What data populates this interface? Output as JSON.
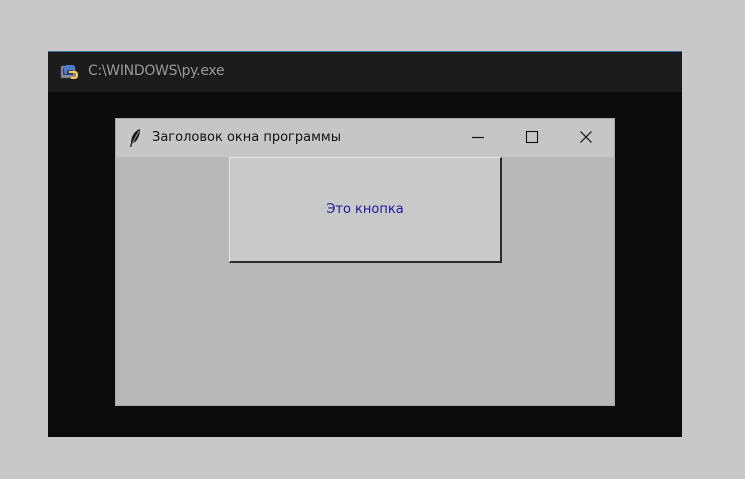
{
  "console": {
    "title": "C:\\WINDOWS\\py.exe",
    "icon": "python-icon"
  },
  "tk_window": {
    "title": "Заголовок окна программы",
    "icon": "tk-feather-icon",
    "controls": {
      "minimize": "minimize-icon",
      "maximize": "maximize-icon",
      "close": "close-icon"
    },
    "button": {
      "label": "Это кнопка"
    }
  },
  "colors": {
    "desktop_background": "#c8c8c8",
    "console_background": "#0c0c0c",
    "tk_background": "#b8b8b8",
    "button_text": "#1a1a9a"
  }
}
